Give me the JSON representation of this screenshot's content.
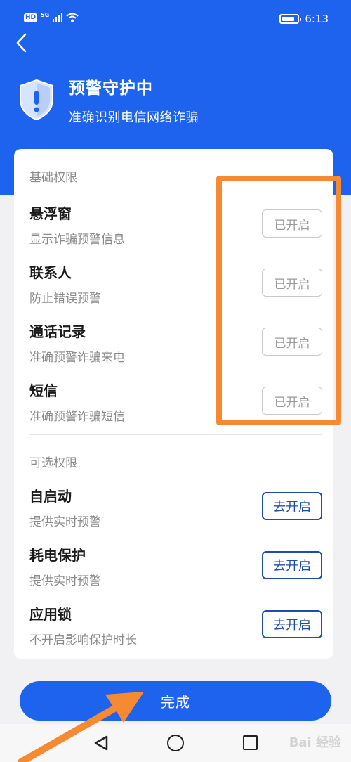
{
  "status_bar": {
    "hd_badge": "HD",
    "network": "5G",
    "time": "6:13",
    "battery_level": 0.85
  },
  "header": {
    "title": "预警守护中",
    "subtitle": "准确识别电信网络诈骗"
  },
  "basic_permissions": {
    "label": "基础权限",
    "items": [
      {
        "title": "悬浮窗",
        "desc": "显示诈骗预警信息",
        "status": "已开启"
      },
      {
        "title": "联系人",
        "desc": "防止错误预警",
        "status": "已开启"
      },
      {
        "title": "通话记录",
        "desc": "准确预警诈骗来电",
        "status": "已开启"
      },
      {
        "title": "短信",
        "desc": "准确预警诈骗短信",
        "status": "已开启"
      }
    ]
  },
  "optional_permissions": {
    "label": "可选权限",
    "items": [
      {
        "title": "自启动",
        "desc": "提供实时预警",
        "action": "去开启"
      },
      {
        "title": "耗电保护",
        "desc": "提供实时预警",
        "action": "去开启"
      },
      {
        "title": "应用锁",
        "desc": "不开启影响保护时长",
        "action": "去开启"
      }
    ]
  },
  "done_button": "完成",
  "watermark": "Bai 经验",
  "colors": {
    "primary": "#1e63ee",
    "action_border": "#1e4ea8",
    "annotation": "#f68a33",
    "background": "#f1f1f3"
  },
  "icons": [
    "back-arrow-icon",
    "shield-icon",
    "wifi-icon",
    "signal-icon",
    "battery-icon",
    "nav-back-icon",
    "nav-home-icon",
    "nav-recent-icon"
  ]
}
